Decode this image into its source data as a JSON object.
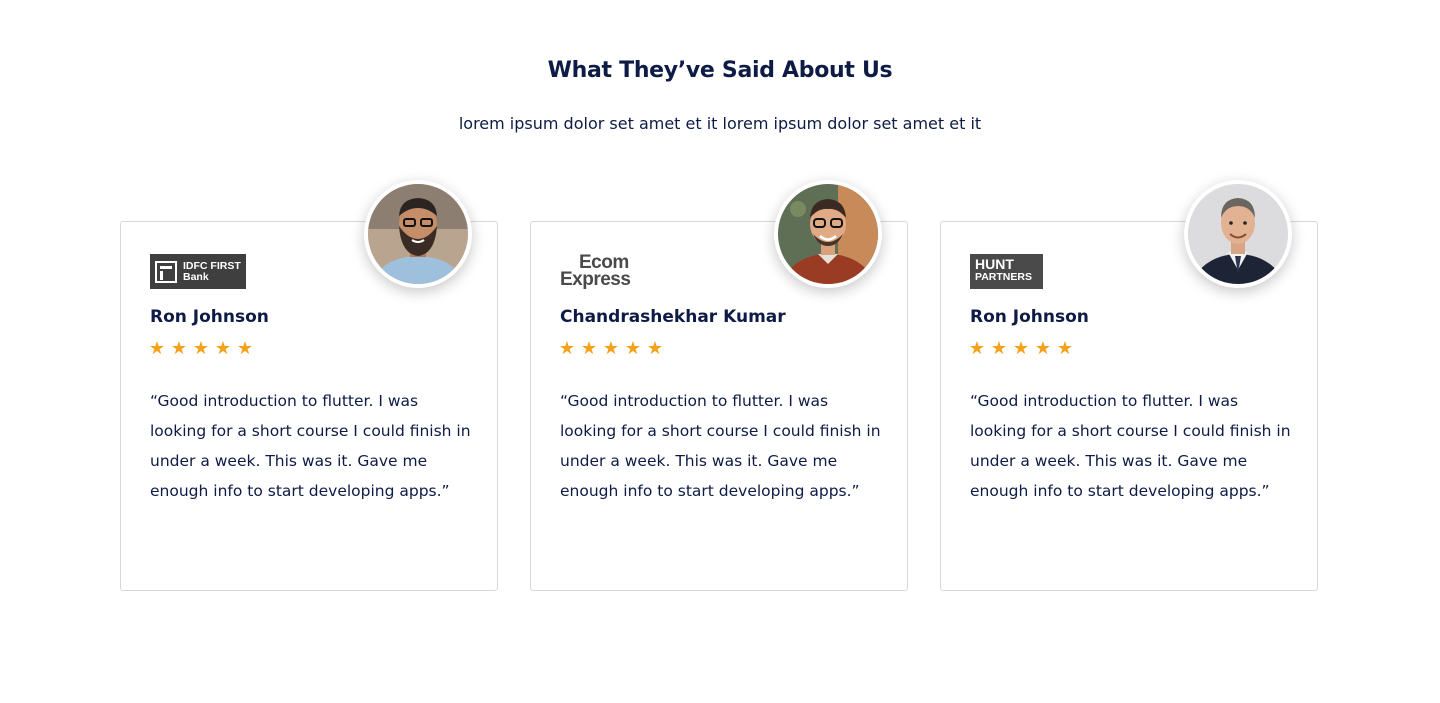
{
  "section": {
    "title": "What They’ve Said About Us",
    "subtitle": "lorem ipsum dolor set amet et it lorem ipsum dolor set amet et it"
  },
  "colors": {
    "text": "#0d1b45",
    "star": "#f5a21b",
    "border": "#d8d8dc"
  },
  "testimonials": [
    {
      "company_logo": {
        "line1": "IDFC FIRST",
        "line2": "Bank"
      },
      "name": "Ron Johnson",
      "rating": 5,
      "quote": "“Good introduction to flutter. I was looking for a short course I could finish in under a week. This was it. Gave me enough info to start developing apps.”",
      "avatar": "bearded-man-glasses-photo"
    },
    {
      "company_logo": {
        "line1": "Ecom",
        "line2": "Express"
      },
      "name": "Chandrashekhar Kumar",
      "rating": 5,
      "quote": "“Good introduction to flutter. I was looking for a short course I could finish in under a week. This was it. Gave me enough info to start developing apps.”",
      "avatar": "smiling-man-glasses-photo"
    },
    {
      "company_logo": {
        "line1": "HUNT",
        "line2": "PARTNERS"
      },
      "name": "Ron Johnson",
      "rating": 5,
      "quote": "“Good introduction to flutter. I was looking for a short course I could finish in under a week. This was it. Gave me enough info to start developing apps.”",
      "avatar": "businessman-suit-photo"
    }
  ]
}
